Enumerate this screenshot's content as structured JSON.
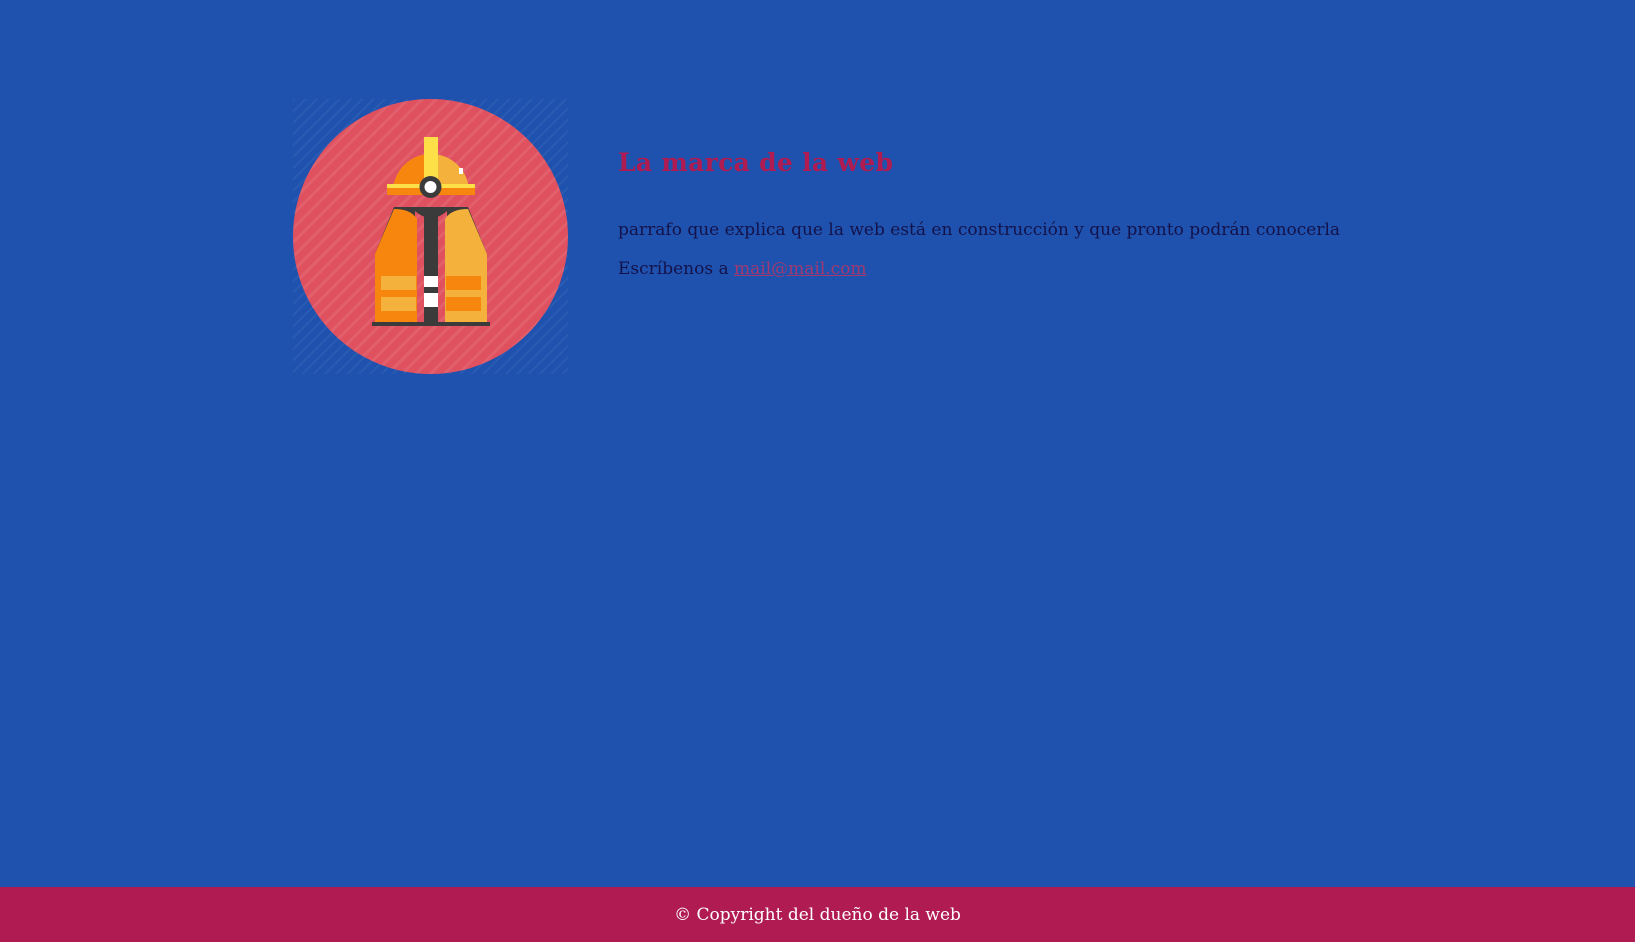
{
  "header": {
    "brand": "La marca de la web"
  },
  "main": {
    "paragraph": "parrafo que explica que la web está en construcción y que pronto podrán conocerla",
    "contact_prefix": "Escríbenos a ",
    "contact_email": "mail@mail.com"
  },
  "logo": {
    "icon": "construction-worker-icon"
  },
  "footer": {
    "copyright": "© Copyright del dueño de la web"
  },
  "colors": {
    "background": "#1f52ae",
    "accent": "#b01c52",
    "circle": "#e05160",
    "text": "#14124a",
    "link": "#a23a6f",
    "footer_text": "#ffffff"
  }
}
